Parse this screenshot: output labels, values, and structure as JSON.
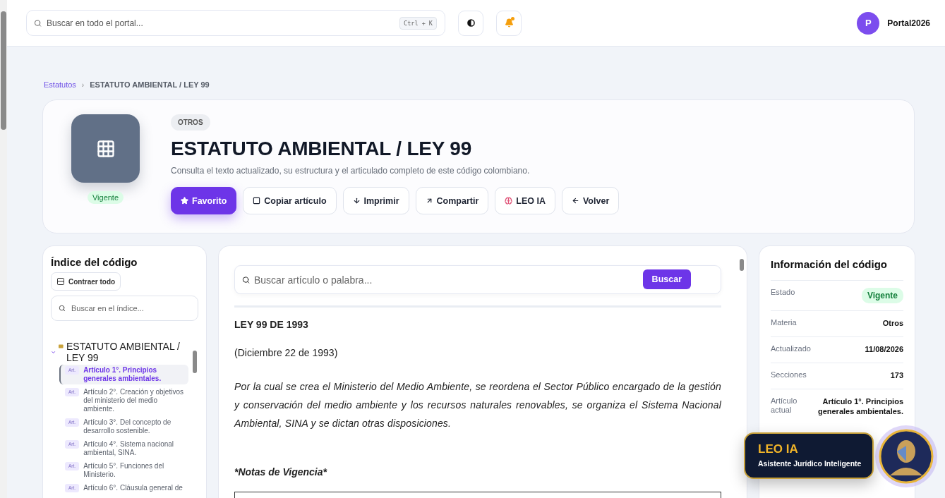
{
  "header": {
    "search": {
      "placeholder": "Buscar en todo el portal...",
      "shortcut": "Ctrl + K"
    },
    "notifications": {
      "unread": true
    },
    "user": {
      "initial": "P",
      "name": "Portal2026"
    }
  },
  "breadcrumb": {
    "separator": "›",
    "items": [
      {
        "label": "Estatutos",
        "link": true
      },
      {
        "label": "ESTATUTO AMBIENTAL / LEY 99",
        "link": false
      }
    ]
  },
  "hero": {
    "status": "Vigente",
    "category": "OTROS",
    "title": "ESTATUTO AMBIENTAL / LEY 99",
    "subtitle": "Consulta el texto actualizado, su estructura y el articulado completo de este código colombiano.",
    "actions": [
      {
        "label": "Favorito",
        "primary": true
      },
      {
        "label": "Copiar artículo",
        "primary": false
      },
      {
        "label": "Imprimir",
        "primary": false
      },
      {
        "label": "Compartir",
        "primary": false
      },
      {
        "label": "LEO IA",
        "primary": false
      },
      {
        "label": "Volver",
        "primary": false
      }
    ]
  },
  "index": {
    "title": "Índice del código",
    "collapse_button": "Contraer todo",
    "search": {
      "placeholder": "Buscar en el índice..."
    },
    "tree": [
      {
        "label": "ESTATUTO AMBIENTAL / LEY 99",
        "expanded": true,
        "children": [
          {
            "tag": "Art.",
            "label": "Artículo 1°. Principios generales ambientales.",
            "selected": true
          },
          {
            "tag": "Art.",
            "label": "Artículo 2°. Creación y objetivos del ministerio del medio ambiente.",
            "selected": false
          },
          {
            "tag": "Art.",
            "label": "Artículo 3°. Del concepto de desarrollo sostenible.",
            "selected": false
          },
          {
            "tag": "Art.",
            "label": "Artículo 4°. Sistema nacional ambiental, SINA.",
            "selected": false
          },
          {
            "tag": "Art.",
            "label": "Artículo 5°. Funciones del Ministerio.",
            "selected": false
          },
          {
            "tag": "Art.",
            "label": "Artículo 6°. Cláusula general de",
            "selected": false
          }
        ]
      }
    ]
  },
  "content": {
    "search": {
      "placeholder": "Buscar artículo o palabra...",
      "button": "Buscar"
    },
    "blocks": [
      {
        "kind": "heading",
        "text": "LEY 99 DE 1993"
      },
      {
        "kind": "plain",
        "text": "(Diciembre 22 de 1993)"
      },
      {
        "kind": "summary",
        "text": "Por la cual se crea el Ministerio del Medio Ambiente, se reordena el Sector Público encargado de la gestión y conservación del medio ambiente y los recursos naturales renovables, se organiza el Sistema Nacional Ambiental, SINA y se dictan otras disposiciones."
      },
      {
        "kind": "note",
        "text": "*Notas de Vigencia*"
      },
      {
        "kind": "table"
      }
    ]
  },
  "info": {
    "title": "Información del código",
    "rows": [
      {
        "label": "Estado",
        "value": "Vigente",
        "kind": "badge"
      },
      {
        "label": "Materia",
        "value": "Otros",
        "kind": "text"
      },
      {
        "label": "Actualizado",
        "value": "11/08/2026",
        "kind": "text"
      },
      {
        "label": "Secciones",
        "value": "173",
        "kind": "text"
      },
      {
        "label": "Artículo actual",
        "value": "Artículo 1°. Principios generales ambientales.",
        "kind": "text"
      }
    ]
  },
  "assistant": {
    "title": "LEO IA",
    "subtitle": "Asistente Jurídico Inteligente"
  }
}
